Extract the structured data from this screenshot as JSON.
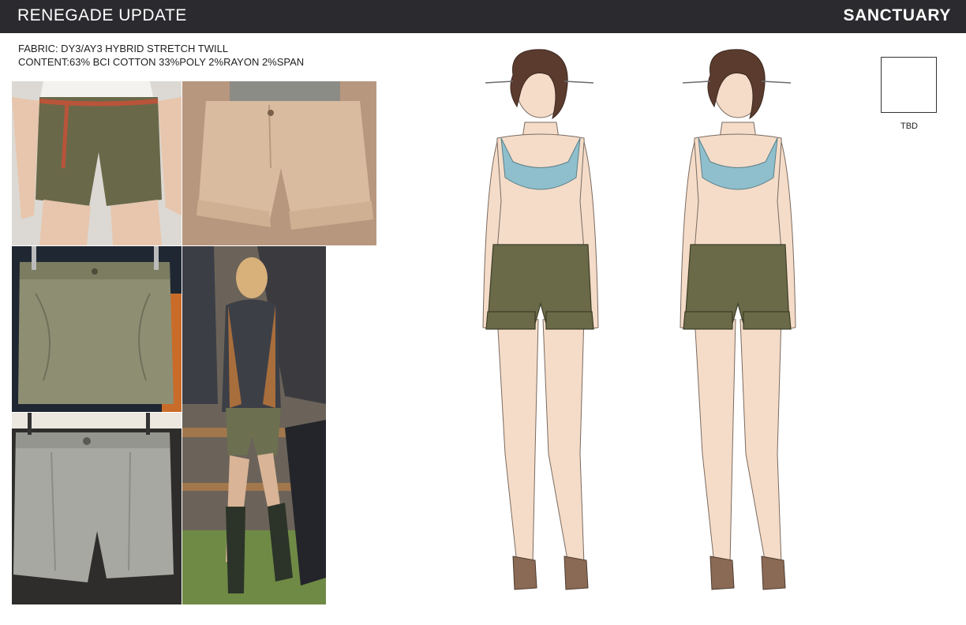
{
  "header": {
    "title": "RENEGADE UPDATE",
    "brand": "SANCTUARY"
  },
  "specs": {
    "fabric": "FABRIC: DY3/AY3 HYBRID STRETCH TWILL",
    "content": "CONTENT:63% BCI COTTON 33%POLY 2%RAYON 2%SPAN"
  },
  "swatch": {
    "label": "TBD",
    "color": "#ffffff"
  },
  "colors": {
    "header_bg": "#2b2b2f",
    "short_olive": "#6a6a48",
    "top_blue": "#8fbfcc",
    "skin": "#f3d9c3",
    "hair": "#5a3b2e",
    "sandal": "#8a6a55"
  }
}
